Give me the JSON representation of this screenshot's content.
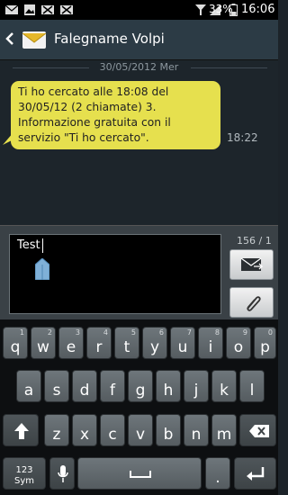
{
  "status_bar": {
    "battery": "33%",
    "time": "16:06"
  },
  "header": {
    "title": "Falegname Volpi"
  },
  "conversation": {
    "date_separator": "30/05/2012 Mer",
    "messages": [
      {
        "lines": [
          "Ti ho cercato alle 18:08 del",
          "30/05/12 (2 chiamate) 3.",
          "Informazione gratuita con il",
          "servizio \"Ti ho cercato\"."
        ],
        "time": "18:22"
      }
    ]
  },
  "compose": {
    "text": "Test",
    "counter": "156 / 1"
  },
  "keyboard": {
    "row1": [
      {
        "key": "q",
        "hint": "1"
      },
      {
        "key": "w",
        "hint": "2"
      },
      {
        "key": "e",
        "hint": "3"
      },
      {
        "key": "r",
        "hint": "4"
      },
      {
        "key": "t",
        "hint": "5"
      },
      {
        "key": "y",
        "hint": "6"
      },
      {
        "key": "u",
        "hint": "7"
      },
      {
        "key": "i",
        "hint": "8"
      },
      {
        "key": "o",
        "hint": "9"
      },
      {
        "key": "p",
        "hint": "0"
      }
    ],
    "row2": [
      "a",
      "s",
      "d",
      "f",
      "g",
      "h",
      "j",
      "k",
      "l"
    ],
    "row3": [
      "z",
      "x",
      "c",
      "v",
      "b",
      "n",
      "m"
    ],
    "sym_top": "123",
    "sym_bottom": "Sym",
    "period": "."
  },
  "colors": {
    "bubble": "#e6e04e",
    "background": "#1d252b",
    "action_bar": "#2c3b45"
  }
}
